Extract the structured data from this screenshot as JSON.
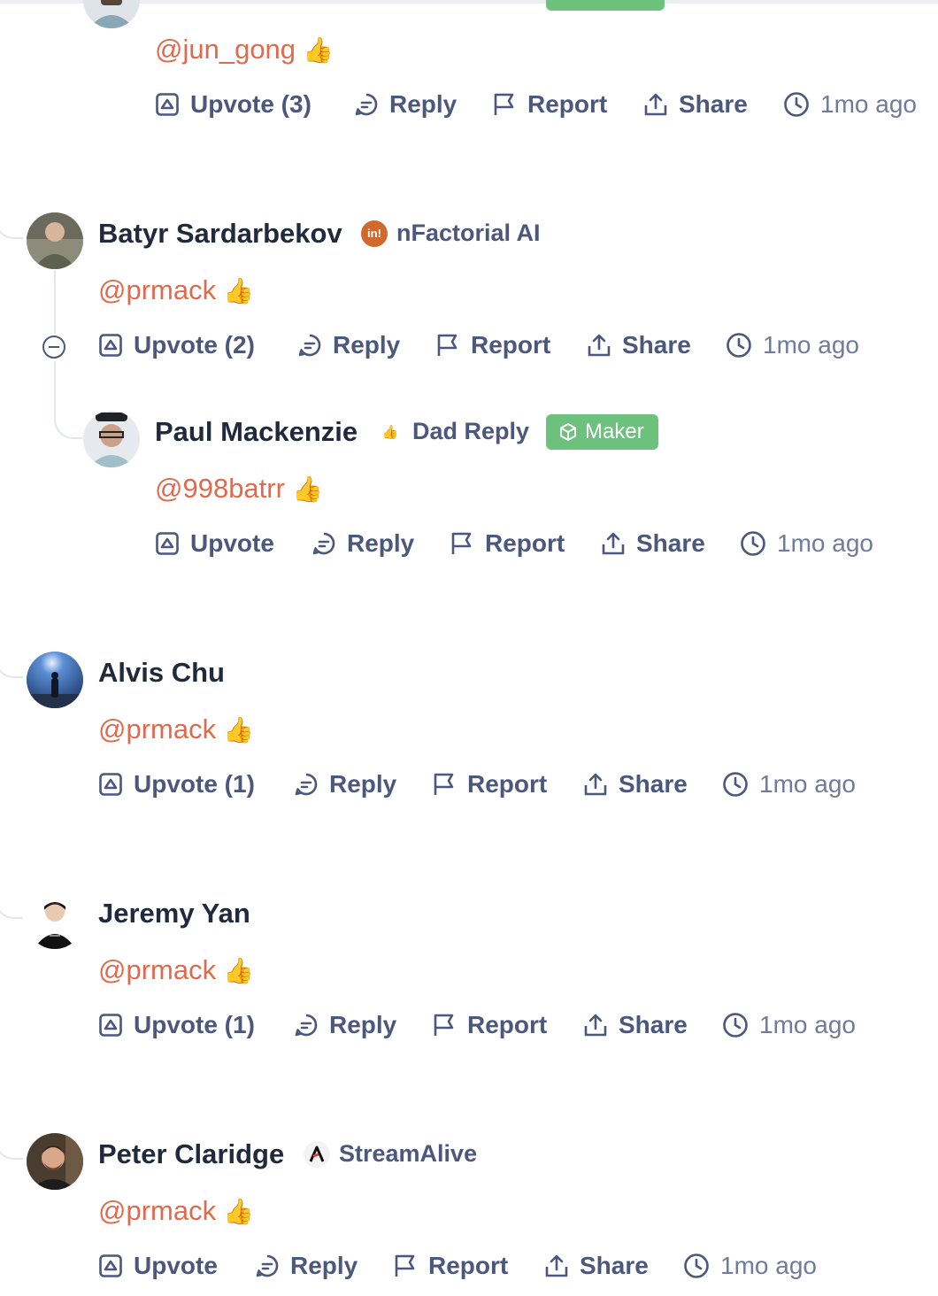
{
  "comments": [
    {
      "id": "c0",
      "author": null,
      "mention": "@jun_gong",
      "reaction": "👍",
      "actions": {
        "upvote": "Upvote (3)",
        "reply": "Reply",
        "report": "Report",
        "share": "Share",
        "time": "1mo ago"
      }
    },
    {
      "id": "c1",
      "author": "Batyr Sardarbekov",
      "company": {
        "name": "nFactorial AI",
        "logo_text": "in!",
        "color": "#d2692c"
      },
      "mention": "@prmack",
      "reaction": "👍",
      "actions": {
        "upvote": "Upvote (2)",
        "reply": "Reply",
        "report": "Report",
        "share": "Share",
        "time": "1mo ago"
      }
    },
    {
      "id": "c2",
      "author": "Paul Mackenzie",
      "company": {
        "name": "Dad Reply",
        "logo_text": "👍",
        "color": "#ffffff"
      },
      "badge": "Maker",
      "mention": "@998batrr",
      "reaction": "👍",
      "actions": {
        "upvote": "Upvote",
        "reply": "Reply",
        "report": "Report",
        "share": "Share",
        "time": "1mo ago"
      }
    },
    {
      "id": "c3",
      "author": "Alvis Chu",
      "mention": "@prmack",
      "reaction": "👍",
      "actions": {
        "upvote": "Upvote (1)",
        "reply": "Reply",
        "report": "Report",
        "share": "Share",
        "time": "1mo ago"
      }
    },
    {
      "id": "c4",
      "author": "Jeremy Yan",
      "mention": "@prmack",
      "reaction": "👍",
      "actions": {
        "upvote": "Upvote (1)",
        "reply": "Reply",
        "report": "Report",
        "share": "Share",
        "time": "1mo ago"
      }
    },
    {
      "id": "c5",
      "author": "Peter Claridge",
      "company": {
        "name": "StreamAlive",
        "logo_text": "A",
        "color": "#ffffff"
      },
      "mention": "@prmack",
      "reaction": "👍",
      "actions": {
        "upvote": "Upvote",
        "reply": "Reply",
        "report": "Report",
        "share": "Share",
        "time": "1mo ago"
      }
    }
  ],
  "colors": {
    "mention": "#e06a4d",
    "action": "#4b587c",
    "maker_badge": "#6cc17d",
    "name": "#21293c"
  }
}
